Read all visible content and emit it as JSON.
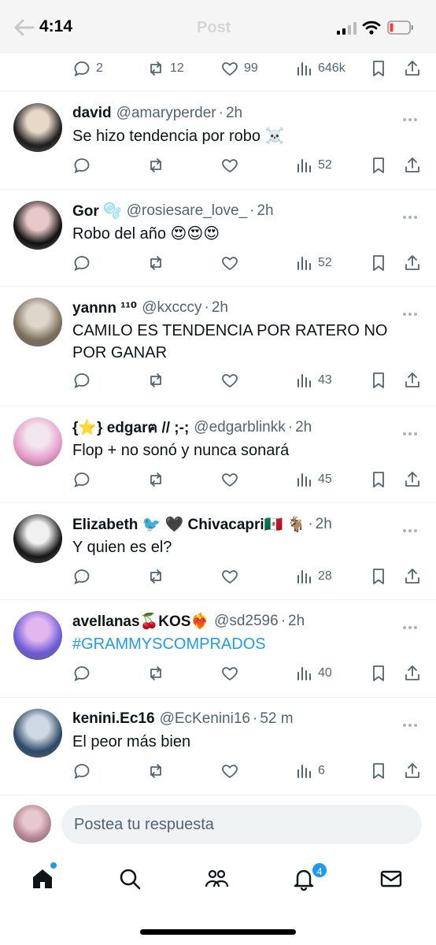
{
  "status_bar": {
    "time": "4:14",
    "faded_title": "Post"
  },
  "top_actions": {
    "replies": "2",
    "reposts": "12",
    "likes": "99",
    "views": "646k"
  },
  "replies": [
    {
      "name": "david",
      "badge": "",
      "handle": "@amaryperder",
      "time": "2h",
      "text": "Se hizo tendencia por robo ☠️",
      "views": "52"
    },
    {
      "name": "Gor 🫧",
      "badge": "",
      "handle": "@rosiesare_love_",
      "time": "2h",
      "text": "Robo del año 😍😍😍",
      "views": "52"
    },
    {
      "name": "yannn ¹¹⁰",
      "badge": "",
      "handle": "@kxcccy",
      "time": "2h",
      "text": "CAMILO ES TENDENCIA POR RATERO NO POR GANAR",
      "views": "43"
    },
    {
      "name": "{⭐} edgarฅ // ;-;",
      "badge": "",
      "handle": "@edgarblinkk",
      "time": "2h",
      "text": "Flop + no sonó y nunca sonará",
      "views": "45"
    },
    {
      "name": "Elizabeth 🐦 🖤 Chivacapri🇲🇽 🐐",
      "badge": "",
      "handle": "",
      "time": "2h",
      "text": "Y quien es el?",
      "views": "28"
    },
    {
      "name": "avellanas🍒KOS❤️‍🔥",
      "badge": "",
      "handle": "@sd2596",
      "time": "2h",
      "text": "#GRAMMYSCOMPRADOS",
      "views": "40"
    },
    {
      "name": "kenini.Ec16",
      "badge": "",
      "handle": "@EcKenini16",
      "time": "52 m",
      "text": "El peor más bien",
      "views": "6"
    }
  ],
  "composer": {
    "placeholder": "Postea tu respuesta"
  },
  "tabbar": {
    "notifications_badge": "4"
  },
  "colors": {
    "accent": "#1d9bf0",
    "muted": "#536471",
    "divider": "#eff3f4"
  }
}
